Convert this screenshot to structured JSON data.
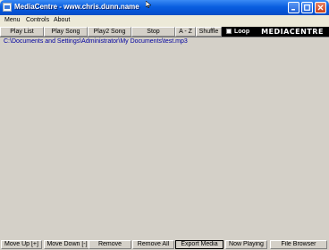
{
  "window": {
    "title": "MediaCentre - www.chris.dunn.name"
  },
  "menu": [
    "Menu",
    "Controls",
    "About"
  ],
  "toolbar": {
    "buttons": [
      "Play List",
      "Play Song",
      "Play2 Song",
      "Stop",
      "A - Z",
      "Shuffle"
    ],
    "loop_label": "Loop",
    "loop_checked": false,
    "logo_text": "MEDIACENTRE"
  },
  "playlist": {
    "entries": [
      "C:\\Documents and Settings\\Administrator\\My Documents\\test.mp3"
    ]
  },
  "bottom": {
    "buttons": [
      "Move Up [+]",
      "Move Down [-]",
      "Remove",
      "Remove All",
      "Export Media",
      "Now Playing",
      "File Browser"
    ],
    "active_index": 4
  },
  "colors": {
    "titlebar": "#0a5fe0",
    "entry_text": "#0000a0",
    "logo_bg": "#000000"
  }
}
